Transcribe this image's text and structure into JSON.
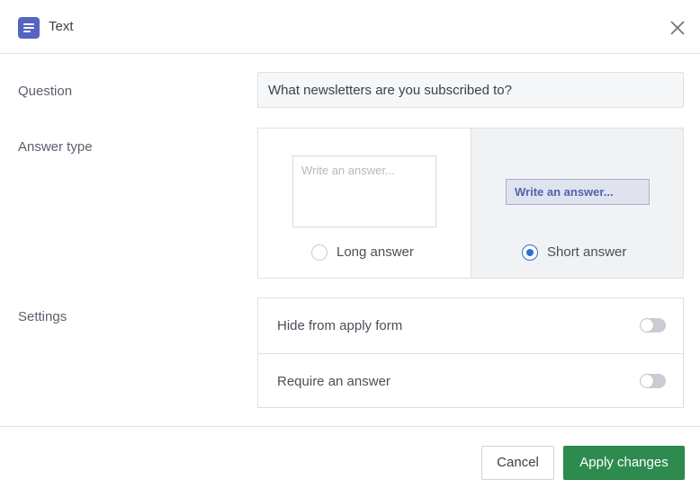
{
  "header": {
    "icon": "text-lines-icon",
    "title": "Text",
    "close_icon": "close-icon"
  },
  "question": {
    "label": "Question",
    "value": "What newsletters are you subscribed to?"
  },
  "answer_type": {
    "label": "Answer type",
    "options": [
      {
        "label": "Long answer",
        "preview_placeholder": "Write an answer...",
        "selected": false
      },
      {
        "label": "Short answer",
        "preview_placeholder": "Write an answer...",
        "selected": true
      }
    ]
  },
  "settings": {
    "label": "Settings",
    "items": [
      {
        "label": "Hide from apply form",
        "enabled": false
      },
      {
        "label": "Require an answer",
        "enabled": false
      }
    ]
  },
  "footer": {
    "cancel_label": "Cancel",
    "apply_label": "Apply changes"
  },
  "colors": {
    "accent_icon": "#5563c1",
    "radio_selected": "#2d6fd6",
    "primary_button": "#2e8b4f"
  }
}
